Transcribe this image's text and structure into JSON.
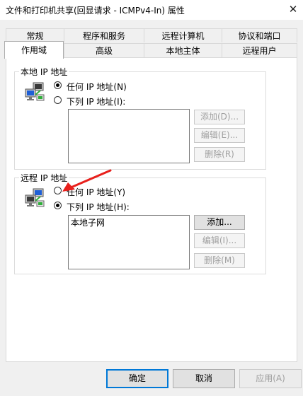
{
  "window": {
    "title": "文件和打印机共享(回显请求 - ICMPv4-In) 属性",
    "close_glyph": "✕"
  },
  "tabs_row1": [
    {
      "label": "常规"
    },
    {
      "label": "程序和服务"
    },
    {
      "label": "远程计算机"
    },
    {
      "label": "协议和端口"
    }
  ],
  "tabs_row2": [
    {
      "label": "作用域",
      "selected": true
    },
    {
      "label": "高级"
    },
    {
      "label": "本地主体"
    },
    {
      "label": "远程用户"
    }
  ],
  "local_ip": {
    "group_title": "本地 IP 地址",
    "icon": "network-computers-icon",
    "option_any": {
      "label": "任何 IP 地址(N)",
      "checked": true
    },
    "option_list": {
      "label": "下列 IP 地址(I):",
      "checked": false
    },
    "entries": [],
    "buttons": {
      "add": "添加(D)...",
      "edit": "编辑(E)...",
      "remove": "删除(R)"
    }
  },
  "remote_ip": {
    "group_title": "远程 IP 地址",
    "icon": "network-computers-icon",
    "option_any": {
      "label": "任何 IP 地址(Y)",
      "checked": false
    },
    "option_list": {
      "label": "下列 IP 地址(H):",
      "checked": true
    },
    "entries": [
      "本地子网"
    ],
    "buttons": {
      "add": "添加...",
      "edit": "编辑(I)...",
      "remove": "删除(M)"
    }
  },
  "dialog_buttons": {
    "ok": "确定",
    "cancel": "取消",
    "apply": "应用(A)"
  },
  "annotation": {
    "arrow_color": "#e8201c"
  }
}
